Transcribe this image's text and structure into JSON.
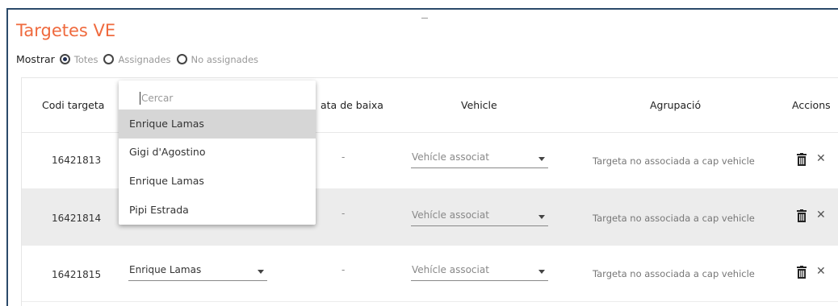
{
  "page": {
    "title": "Targetes VE"
  },
  "filter": {
    "label": "Mostrar",
    "options": [
      "Totes",
      "Assignades",
      "No assignades"
    ],
    "selected": "Totes"
  },
  "table": {
    "headers": {
      "codi": "Codi targeta",
      "baixa": "ata de baixa",
      "vehicle": "Vehicle",
      "agrupacio": "Agrupació",
      "accions": "Accions"
    },
    "rows": [
      {
        "codi": "16421813",
        "baixa": "-",
        "vehicle": "Vehícle associat",
        "agrupacio": "Targeta no associada a cap vehicle"
      },
      {
        "codi": "16421814",
        "baixa": "-",
        "vehicle": "Vehícle associat",
        "agrupacio": "Targeta no associada a cap vehicle"
      },
      {
        "codi": "16421815",
        "user": "Enrique Lamas",
        "baixa": "-",
        "vehicle": "Vehícle associat",
        "agrupacio": "Targeta no associada a cap vehicle"
      }
    ]
  },
  "dropdown": {
    "search_placeholder": "Cercar",
    "options": [
      "Enrique Lamas",
      "Gigi d'Agostino",
      "Enrique Lamas",
      "Pipi Estrada"
    ],
    "highlighted_index": 0
  },
  "icons": {
    "delete": "trash-icon",
    "close": "close-icon"
  },
  "colors": {
    "title": "#ef6a3e",
    "frame": "#2b4a6a",
    "radio_selected": "#1f2d52",
    "row_shade": "#ececec",
    "highlight": "#d6d6d6"
  }
}
